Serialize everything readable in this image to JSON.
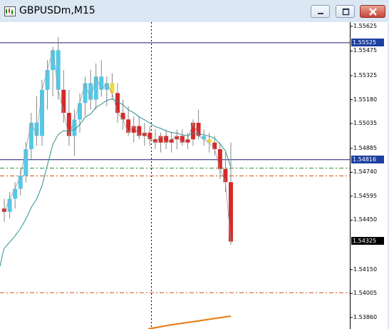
{
  "window": {
    "title": "GBPUSDm,M15",
    "controls": {
      "minimize_icon": "minimize-icon",
      "maximize_icon": "restore-icon",
      "close_icon": "close-icon"
    }
  },
  "colors": {
    "bear_candle": "#d42a2a",
    "bull_candle": "#55c8e8",
    "neutral_candle": "#f0d93a",
    "wick": "#888888",
    "ma_line": "#2e8f8f",
    "orange_line": "#e8801a",
    "grid_dash_green": "#2c8a2c",
    "grid_dash_orange": "#d05010",
    "hline": "#1a1a7a",
    "label_box_blue": "#1c3fa0"
  },
  "price_axis": {
    "ticks": [
      "1.55625",
      "1.55475",
      "1.55325",
      "1.55180",
      "1.55035",
      "1.54885",
      "1.54740",
      "1.54595",
      "1.54450",
      "1.54150",
      "1.54005",
      "1.53860"
    ],
    "highlight_labels": [
      {
        "name": "level-high",
        "text": "1.55525",
        "style": "blue"
      },
      {
        "name": "bid-line",
        "text": "1.54816",
        "style": "blue"
      },
      {
        "name": "current-price",
        "text": "1.54325",
        "style": "black"
      }
    ]
  },
  "chart_data": {
    "type": "candlestick",
    "symbol": "GBPUSDm",
    "timeframe": "M15",
    "y_min": 1.5379,
    "y_max": 1.5565,
    "horizontal_levels": [
      1.55525,
      1.54816,
      1.54765,
      1.54718,
      1.5401
    ],
    "candles": [
      [
        1.5452,
        1.5458,
        1.5444,
        1.545,
        0
      ],
      [
        1.545,
        1.5462,
        1.5446,
        1.5458,
        1
      ],
      [
        1.5458,
        1.5468,
        1.5452,
        1.5464,
        1
      ],
      [
        1.5464,
        1.5476,
        1.546,
        1.5472,
        1
      ],
      [
        1.5472,
        1.5492,
        1.5468,
        1.5488,
        1
      ],
      [
        1.5488,
        1.551,
        1.5482,
        1.5504,
        1
      ],
      [
        1.5504,
        1.552,
        1.549,
        1.5496,
        1
      ],
      [
        1.5496,
        1.553,
        1.549,
        1.5524,
        1
      ],
      [
        1.5524,
        1.5542,
        1.5512,
        1.5536,
        1
      ],
      [
        1.5536,
        1.555,
        1.552,
        1.5548,
        1
      ],
      [
        1.5548,
        1.5556,
        1.5518,
        1.5524,
        1
      ],
      [
        1.5524,
        1.5536,
        1.5504,
        1.551,
        0
      ],
      [
        1.551,
        1.5524,
        1.549,
        1.5496,
        0
      ],
      [
        1.5496,
        1.5512,
        1.5484,
        1.5506,
        1
      ],
      [
        1.5506,
        1.5522,
        1.5498,
        1.5516,
        1
      ],
      [
        1.5516,
        1.5532,
        1.5508,
        1.5528,
        1
      ],
      [
        1.5528,
        1.5536,
        1.5512,
        1.5518,
        1
      ],
      [
        1.5518,
        1.554,
        1.5512,
        1.5532,
        1
      ],
      [
        1.5532,
        1.5542,
        1.552,
        1.5524,
        1
      ],
      [
        1.5524,
        1.5532,
        1.5514,
        1.5528,
        1
      ],
      [
        1.5528,
        1.5534,
        1.5518,
        1.5522,
        2
      ],
      [
        1.5522,
        1.5528,
        1.5504,
        1.551,
        0
      ],
      [
        1.551,
        1.5518,
        1.55,
        1.5506,
        0
      ],
      [
        1.5506,
        1.5514,
        1.5496,
        1.5498,
        0
      ],
      [
        1.5498,
        1.5508,
        1.5492,
        1.5502,
        0
      ],
      [
        1.5502,
        1.5508,
        1.5494,
        1.5496,
        0
      ],
      [
        1.5496,
        1.5504,
        1.549,
        1.5498,
        0
      ],
      [
        1.5498,
        1.5502,
        1.549,
        1.5494,
        0
      ],
      [
        1.5494,
        1.55,
        1.5488,
        1.5492,
        0
      ],
      [
        1.5492,
        1.5498,
        1.5486,
        1.5496,
        0
      ],
      [
        1.5496,
        1.55,
        1.5488,
        1.5492,
        0
      ],
      [
        1.5492,
        1.5498,
        1.5486,
        1.5494,
        0
      ],
      [
        1.5494,
        1.55,
        1.5488,
        1.5496,
        0
      ],
      [
        1.5496,
        1.55,
        1.549,
        1.5492,
        0
      ],
      [
        1.5492,
        1.5498,
        1.5488,
        1.5494,
        0
      ],
      [
        1.5494,
        1.5506,
        1.549,
        1.5504,
        0
      ],
      [
        1.5504,
        1.5512,
        1.5494,
        1.5496,
        0
      ],
      [
        1.5496,
        1.55,
        1.549,
        1.5494,
        1
      ],
      [
        1.5494,
        1.5498,
        1.5486,
        1.5492,
        2
      ],
      [
        1.5492,
        1.5496,
        1.5484,
        1.5488,
        0
      ],
      [
        1.5488,
        1.5492,
        1.547,
        1.5476,
        0
      ],
      [
        1.5476,
        1.5486,
        1.5462,
        1.5468,
        0
      ],
      [
        1.5468,
        1.5492,
        1.543,
        1.5432,
        0
      ]
    ]
  }
}
